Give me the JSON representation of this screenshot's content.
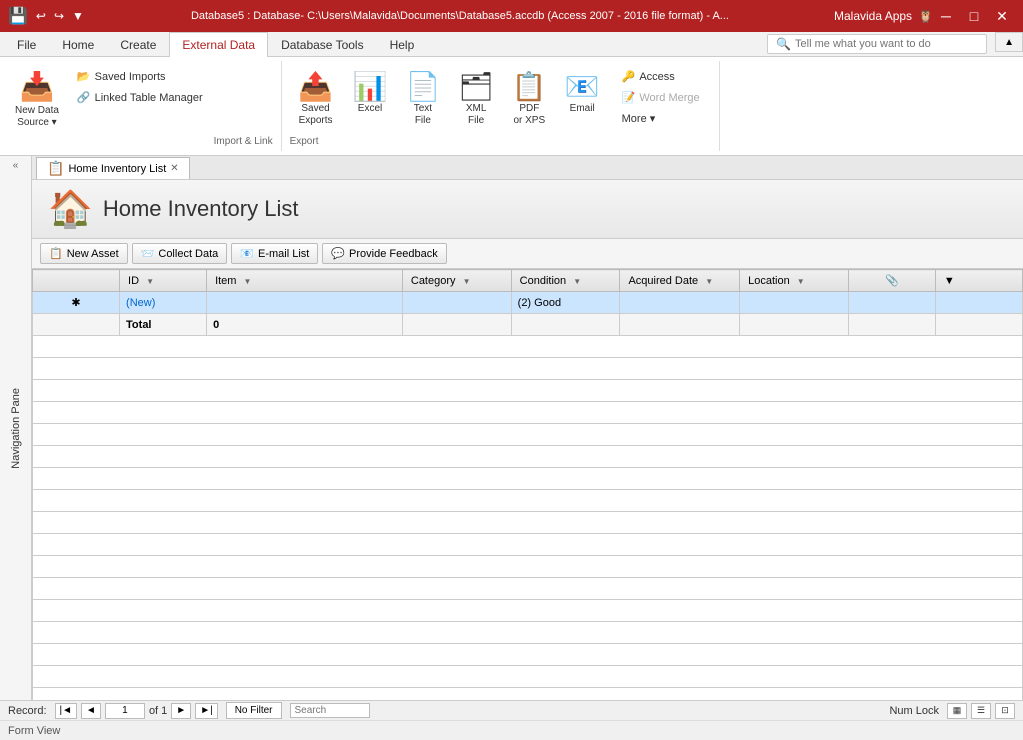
{
  "titleBar": {
    "title": "Database5 : Database- C:\\Users\\Malavida\\Documents\\Database5.accdb (Access 2007 - 2016 file format) - A...",
    "brand": "Malavida Apps",
    "saveIcon": "💾",
    "undoIcon": "↩",
    "redoIcon": "↪",
    "dropdownIcon": "▼",
    "minIcon": "─",
    "maxIcon": "□",
    "closeIcon": "✕"
  },
  "ribbon": {
    "tabs": [
      "File",
      "Home",
      "Create",
      "External Data",
      "Database Tools",
      "Help"
    ],
    "activeTab": "External Data",
    "searchPlaceholder": "Tell me what you want to do",
    "groups": {
      "importLink": {
        "label": "Import & Link",
        "newDataSource": {
          "label": "New Data\nSource",
          "icon": "📥"
        },
        "savedImports": "Saved Imports",
        "linkedTableManager": "Linked Table Manager"
      },
      "export": {
        "label": "Export",
        "savedExports": {
          "label": "Saved\nExports",
          "icon": "📤"
        },
        "excel": {
          "label": "Excel",
          "icon": "📊"
        },
        "textFile": {
          "label": "Text\nFile",
          "icon": "📄"
        },
        "xmlFile": {
          "label": "XML\nFile",
          "icon": "🗂"
        },
        "pdfOrXps": {
          "label": "PDF\nor XPS",
          "icon": "📋"
        },
        "email": {
          "label": "Email",
          "icon": "📧"
        },
        "access": "Access",
        "wordMerge": "Word Merge",
        "more": "More ▾"
      }
    },
    "collapseBtn": "▲"
  },
  "docTab": {
    "icon": "📋",
    "label": "Home Inventory List",
    "closeIcon": "✕"
  },
  "docHeader": {
    "icon": "🏠",
    "title": "Home Inventory List"
  },
  "toolbar": {
    "newAsset": "New Asset",
    "collectData": "Collect Data",
    "emailList": "E-mail List",
    "provideFeedback": "Provide Feedback"
  },
  "table": {
    "columns": [
      "ID",
      "Item",
      "Category",
      "Condition",
      "Acquired Date",
      "Location",
      "📎",
      ""
    ],
    "newRow": {
      "id": "(New)",
      "condition": "(2) Good"
    },
    "totalRow": {
      "label": "Total",
      "value": "0"
    }
  },
  "navPane": {
    "label": "Navigation Pane",
    "arrow": "«"
  },
  "statusBar": {
    "recordLabel": "Record:",
    "recordFirst": "|◄",
    "recordPrev": "◄",
    "recordCurrent": "1",
    "recordOf": "of 1",
    "recordNext": "►",
    "recordLast": "►|",
    "noFilter": "No Filter",
    "searchPlaceholder": "Search",
    "numLock": "Num Lock"
  },
  "bottomBar": {
    "label": "Form View"
  }
}
